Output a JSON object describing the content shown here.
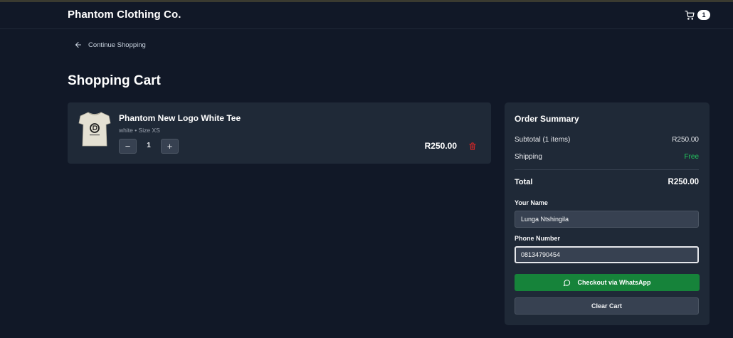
{
  "header": {
    "brand": "Phantom Clothing Co.",
    "cart_count": "1"
  },
  "nav": {
    "back_label": "Continue Shopping"
  },
  "page": {
    "title": "Shopping Cart"
  },
  "cart": {
    "items": [
      {
        "name": "Phantom New Logo White Tee",
        "variant": "white • Size XS",
        "quantity": "1",
        "price": "R250.00",
        "decrease_label": "−",
        "increase_label": "+"
      }
    ]
  },
  "summary": {
    "title": "Order Summary",
    "subtotal_label": "Subtotal (1 items)",
    "subtotal_value": "R250.00",
    "shipping_label": "Shipping",
    "shipping_value": "Free",
    "total_label": "Total",
    "total_value": "R250.00",
    "name_label": "Your Name",
    "name_value": "Lunga Ntshingila",
    "phone_label": "Phone Number",
    "phone_value": "08134790454",
    "checkout_label": "Checkout via WhatsApp",
    "clear_label": "Clear Cart"
  },
  "colors": {
    "background": "#111827",
    "card": "#1f2937",
    "accent_green": "#16833a",
    "free_green": "#22c55e",
    "trash_red": "#dc2626"
  },
  "icons": {
    "cart": "shopping-cart-icon",
    "back": "arrow-left-icon",
    "trash": "trash-icon",
    "whatsapp": "whatsapp-icon"
  }
}
